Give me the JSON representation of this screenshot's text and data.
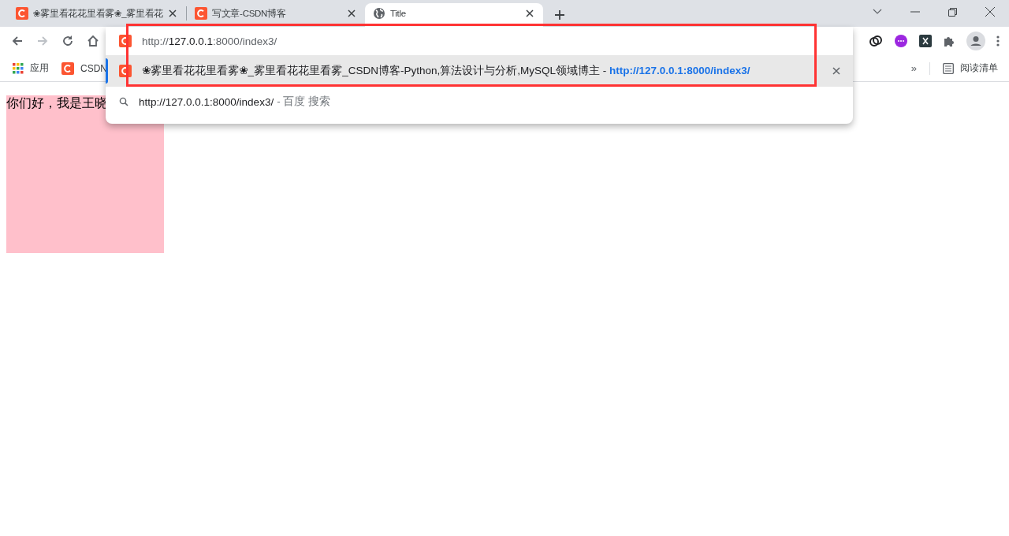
{
  "tabs": [
    {
      "title": "❀雾里看花花里看雾❀_雾里看花",
      "kind": "csdn",
      "selected": false
    },
    {
      "title": "写文章-CSDN博客",
      "kind": "csdn",
      "selected": false
    },
    {
      "title": "Title",
      "kind": "globe",
      "selected": true
    }
  ],
  "nav_buttons": [
    {
      "kind": "back",
      "disabled": false
    },
    {
      "kind": "forward",
      "disabled": true
    },
    {
      "kind": "reload",
      "disabled": false
    },
    {
      "kind": "home",
      "disabled": false
    }
  ],
  "bookmarks": {
    "items": [
      {
        "label": "应用",
        "kind": "apps"
      },
      {
        "label": "CSDN",
        "kind": "csdn"
      }
    ],
    "overflow": "»",
    "reading_list": "阅读清单"
  },
  "omnibox": {
    "input": "http://**127.0.0.1**:8000/index3/",
    "suggestions": [
      {
        "kind": "history",
        "text": "❀雾里看花花里看雾❀_雾里看花花里看雾_CSDN博客-Python,算法设计与分析,MySQL领域博主 - **http://127.0.0.1:8000/index3/**",
        "selected": true
      },
      {
        "kind": "search",
        "query": "http://127.0.0.1:8000/index3/",
        "suffix": "- 百度 搜索",
        "selected": false
      }
    ]
  },
  "page": {
    "text": "你们好，我是王晓"
  }
}
